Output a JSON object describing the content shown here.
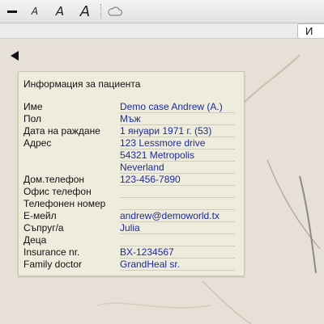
{
  "toolbar": {
    "font_smaller_label": "A",
    "font_normal_label": "A",
    "font_larger_label": "A",
    "icons": [
      "minus-icon",
      "cloud-icon"
    ]
  },
  "tabbar": {
    "right_tab_label": "И"
  },
  "panel": {
    "title": "Информация за пациента",
    "rows": [
      {
        "label": "Име",
        "value": "Demo case Andrew (A.)"
      },
      {
        "label": "Пол",
        "value": "Мъж"
      },
      {
        "label": "Дата на раждане",
        "value": "1 януари 1971 г. (53)"
      },
      {
        "label": "Адрес",
        "value": "123 Lessmore drive"
      },
      {
        "label": "",
        "value": "54321  Metropolis"
      },
      {
        "label": "",
        "value": "Neverland"
      },
      {
        "label": "Дом.телефон",
        "value": "123-456-7890"
      },
      {
        "label": "Офис телефон",
        "value": ""
      },
      {
        "label": "Телефонен номер",
        "value": ""
      },
      {
        "label": "Е-мейл",
        "value": "andrew@demoworld.tx"
      },
      {
        "label": "Съпруг/а",
        "value": "Julia"
      },
      {
        "label": "Деца",
        "value": ""
      },
      {
        "label": "Insurance nr.",
        "value": "BX-1234567"
      },
      {
        "label": "Family doctor",
        "value": "GrandHeal sr."
      }
    ]
  },
  "colors": {
    "value_text": "#1c2a9c",
    "panel_bg": "#eeecdc",
    "page_bg": "#e6e0d6"
  }
}
